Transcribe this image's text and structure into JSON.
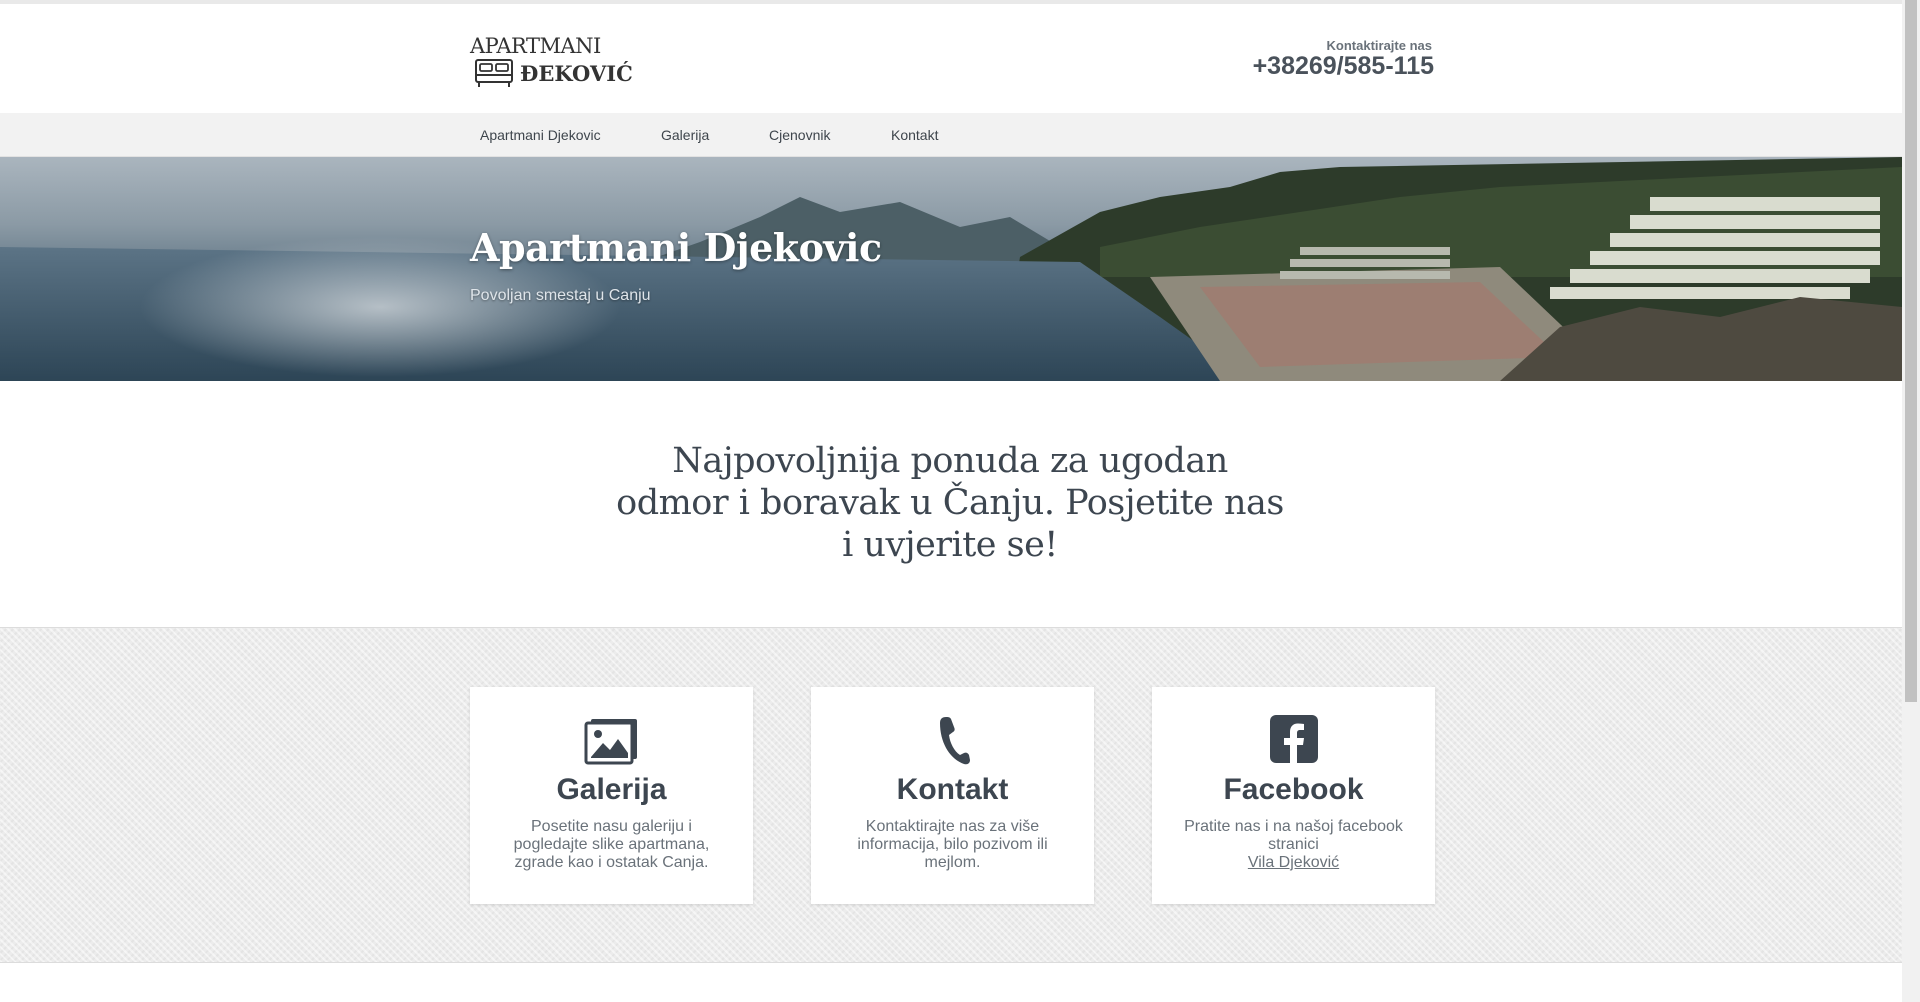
{
  "header": {
    "logo_line1": "APARTMANI",
    "logo_line2": "ĐEKOVIĆ",
    "contact_label": "Kontaktirajte nas",
    "contact_phone": "+38269/585-115"
  },
  "nav": {
    "items": [
      {
        "label": "Apartmani Djekovic"
      },
      {
        "label": "Galerija"
      },
      {
        "label": "Cjenovnik"
      },
      {
        "label": "Kontakt"
      }
    ]
  },
  "hero": {
    "title": "Apartmani Djekovic",
    "subtitle": "Povoljan smestaj u Canju"
  },
  "tagline": {
    "line1": "Najpovoljnija ponuda za ugodan",
    "line2": "odmor i boravak u Čanju. Posjetite nas",
    "line3": "i uvjerite se!"
  },
  "cards": [
    {
      "icon": "image-gallery-icon",
      "title": "Galerija",
      "text": "Posetite nasu galeriju i pogledajte slike apartmana, zgrade kao i ostatak Canja."
    },
    {
      "icon": "phone-icon",
      "title": "Kontakt",
      "text": "Kontaktirajte nas za više informacija, bilo pozivom ili mejlom."
    },
    {
      "icon": "facebook-icon",
      "title": "Facebook",
      "text": "Pratite nas i na našoj facebook stranici",
      "link": "Vila Djeković"
    }
  ],
  "colors": {
    "text": "#3d4650",
    "muted": "#6a727a",
    "nav_bg": "#f2f2f2",
    "features_bg": "#ececec"
  }
}
